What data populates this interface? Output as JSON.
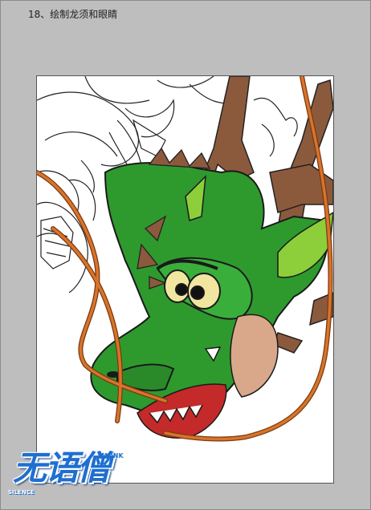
{
  "tutorial": {
    "step_title": "18、绘制龙须和眼睛"
  },
  "watermark": {
    "main_text": "无语僧",
    "top_right_text": "MONK",
    "bottom_left_text": "SILENCE",
    "color": "#1e6fd0"
  },
  "colors": {
    "background": "#bebebe",
    "canvas": "#ffffff",
    "dragon_green": "#2e9a2e",
    "dragon_light_green": "#8ccf3a",
    "horn_brown": "#8b5a3c",
    "whisker_orange": "#d8742a",
    "mouth_red": "#c42a2a",
    "skin_tan": "#d9a88a",
    "eye_yellow": "#f0e6a0"
  }
}
